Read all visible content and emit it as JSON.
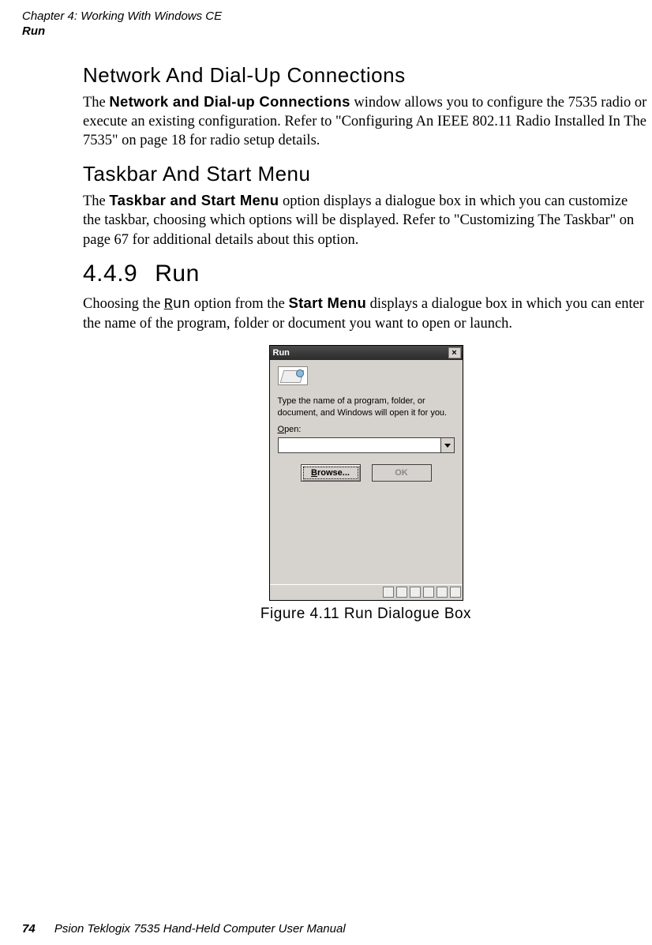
{
  "header": {
    "chapter_line": "Chapter 4: Working With Windows CE",
    "section_line": "Run"
  },
  "sections": {
    "net": {
      "title": "Network And Dial-Up Connections",
      "para_pre": "The ",
      "bold_phrase": "Network and Dial-up Connections",
      "para_post": " window allows you to configure the 7535 radio or execute an existing configuration. Refer to \"Configuring An IEEE 802.11 Radio Installed In The 7535\" on page 18 for radio setup details."
    },
    "taskbar": {
      "title": "Taskbar And Start Menu",
      "para_pre": "The  ",
      "bold_phrase": "Taskbar and Start Menu",
      "para_post": "  option displays a dialogue box in which you can customize the taskbar, choosing which options will be displayed. Refer to \"Customizing The Taskbar\" on page 67 for additional details about this option."
    },
    "run": {
      "number": "4.4.9",
      "title": "Run",
      "para_pre": "Choosing the ",
      "mono_phrase": "Run",
      "para_mid": " option from the ",
      "bold_phrase": "Start Menu",
      "para_post": " displays a dialogue box in which you can enter the name of the program, folder or document you want to open or launch."
    }
  },
  "dialog": {
    "title": "Run",
    "body_text": "Type the name of a program, folder, or document, and Windows will open it for you.",
    "open_label": "Open:",
    "input_placeholder": "",
    "browse_label": "Browse...",
    "ok_label": "OK"
  },
  "figure": {
    "caption": "Figure 4.11 Run Dialogue Box"
  },
  "footer": {
    "page_number": "74",
    "text": "Psion Teklogix 7535 Hand-Held Computer User Manual"
  }
}
